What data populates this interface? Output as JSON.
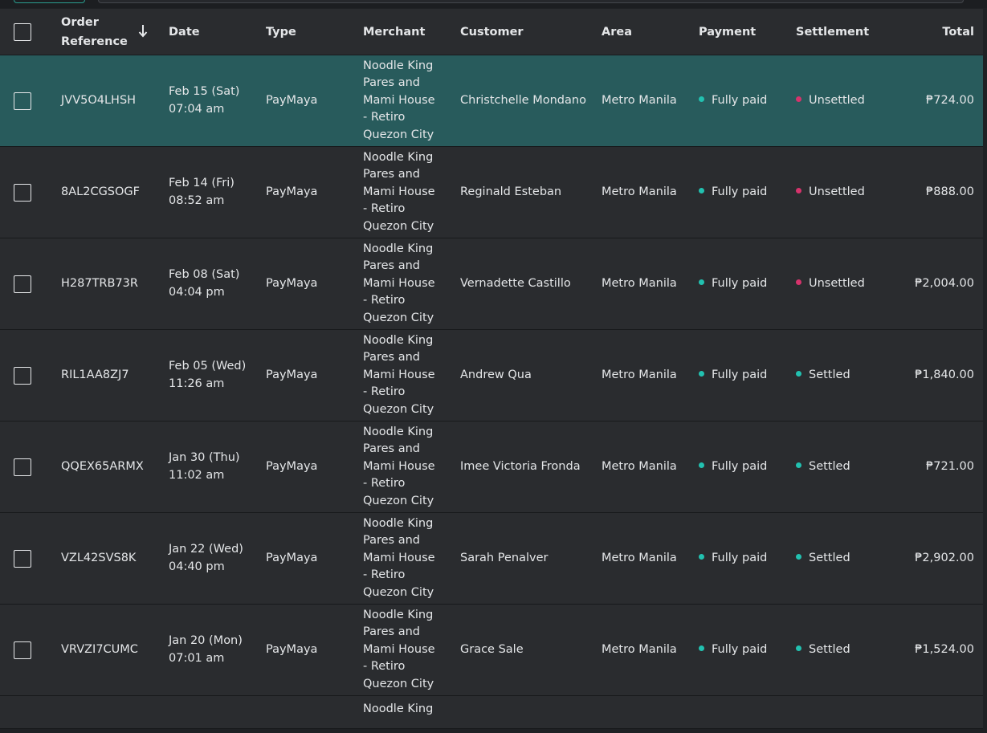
{
  "colors": {
    "background": "#1f2124",
    "row": "#2a2c2f",
    "selected_row": "#285b5c",
    "paid_dot": "#22c1b0",
    "unsettled_dot": "#d6336c",
    "settled_dot": "#22c1b0"
  },
  "table": {
    "columns": {
      "order_reference_line1": "Order",
      "order_reference_line2": "Reference",
      "date": "Date",
      "type": "Type",
      "merchant": "Merchant",
      "customer": "Customer",
      "area": "Area",
      "payment": "Payment",
      "settlement": "Settlement",
      "total": "Total"
    },
    "sort_icon": "arrow-down-icon",
    "rows": [
      {
        "ref": "JVV5O4LHSH",
        "date1": "Feb 15 (Sat)",
        "date2": "07:04 am",
        "type": "PayMaya",
        "merchant": [
          "Noodle King",
          "Pares and",
          "Mami House",
          "- Retiro",
          "Quezon City"
        ],
        "customer": "Christchelle Mondano",
        "area": "Metro Manila",
        "payment": "Fully paid",
        "settlement": "Unsettled",
        "settlement_status": "unsettled",
        "total": "₱724.00",
        "selected": true
      },
      {
        "ref": "8AL2CGSOGF",
        "date1": "Feb 14 (Fri)",
        "date2": "08:52 am",
        "type": "PayMaya",
        "merchant": [
          "Noodle King",
          "Pares and",
          "Mami House",
          "- Retiro",
          "Quezon City"
        ],
        "customer": "Reginald Esteban",
        "area": "Metro Manila",
        "payment": "Fully paid",
        "settlement": "Unsettled",
        "settlement_status": "unsettled",
        "total": "₱888.00",
        "selected": false
      },
      {
        "ref": "H287TRB73R",
        "date1": "Feb 08 (Sat)",
        "date2": "04:04 pm",
        "type": "PayMaya",
        "merchant": [
          "Noodle King",
          "Pares and",
          "Mami House",
          "- Retiro",
          "Quezon City"
        ],
        "customer": "Vernadette Castillo",
        "area": "Metro Manila",
        "payment": "Fully paid",
        "settlement": "Unsettled",
        "settlement_status": "unsettled",
        "total": "₱2,004.00",
        "selected": false
      },
      {
        "ref": "RIL1AA8ZJ7",
        "date1": "Feb 05 (Wed)",
        "date2": "11:26 am",
        "type": "PayMaya",
        "merchant": [
          "Noodle King",
          "Pares and",
          "Mami House",
          "- Retiro",
          "Quezon City"
        ],
        "customer": "Andrew Qua",
        "area": "Metro Manila",
        "payment": "Fully paid",
        "settlement": "Settled",
        "settlement_status": "settled",
        "total": "₱1,840.00",
        "selected": false
      },
      {
        "ref": "QQEX65ARMX",
        "date1": "Jan 30 (Thu)",
        "date2": "11:02 am",
        "type": "PayMaya",
        "merchant": [
          "Noodle King",
          "Pares and",
          "Mami House",
          "- Retiro",
          "Quezon City"
        ],
        "customer": "Imee Victoria Fronda",
        "area": "Metro Manila",
        "payment": "Fully paid",
        "settlement": "Settled",
        "settlement_status": "settled",
        "total": "₱721.00",
        "selected": false
      },
      {
        "ref": "VZL42SVS8K",
        "date1": "Jan 22 (Wed)",
        "date2": "04:40 pm",
        "type": "PayMaya",
        "merchant": [
          "Noodle King",
          "Pares and",
          "Mami House",
          "- Retiro",
          "Quezon City"
        ],
        "customer": "Sarah Penalver",
        "area": "Metro Manila",
        "payment": "Fully paid",
        "settlement": "Settled",
        "settlement_status": "settled",
        "total": "₱2,902.00",
        "selected": false
      },
      {
        "ref": "VRVZI7CUMC",
        "date1": "Jan 20 (Mon)",
        "date2": "07:01 am",
        "type": "PayMaya",
        "merchant": [
          "Noodle King",
          "Pares and",
          "Mami House",
          "- Retiro",
          "Quezon City"
        ],
        "customer": "Grace Sale",
        "area": "Metro Manila",
        "payment": "Fully paid",
        "settlement": "Settled",
        "settlement_status": "settled",
        "total": "₱1,524.00",
        "selected": false
      }
    ],
    "partial_row": {
      "merchant_first_line": "Noodle King"
    }
  }
}
